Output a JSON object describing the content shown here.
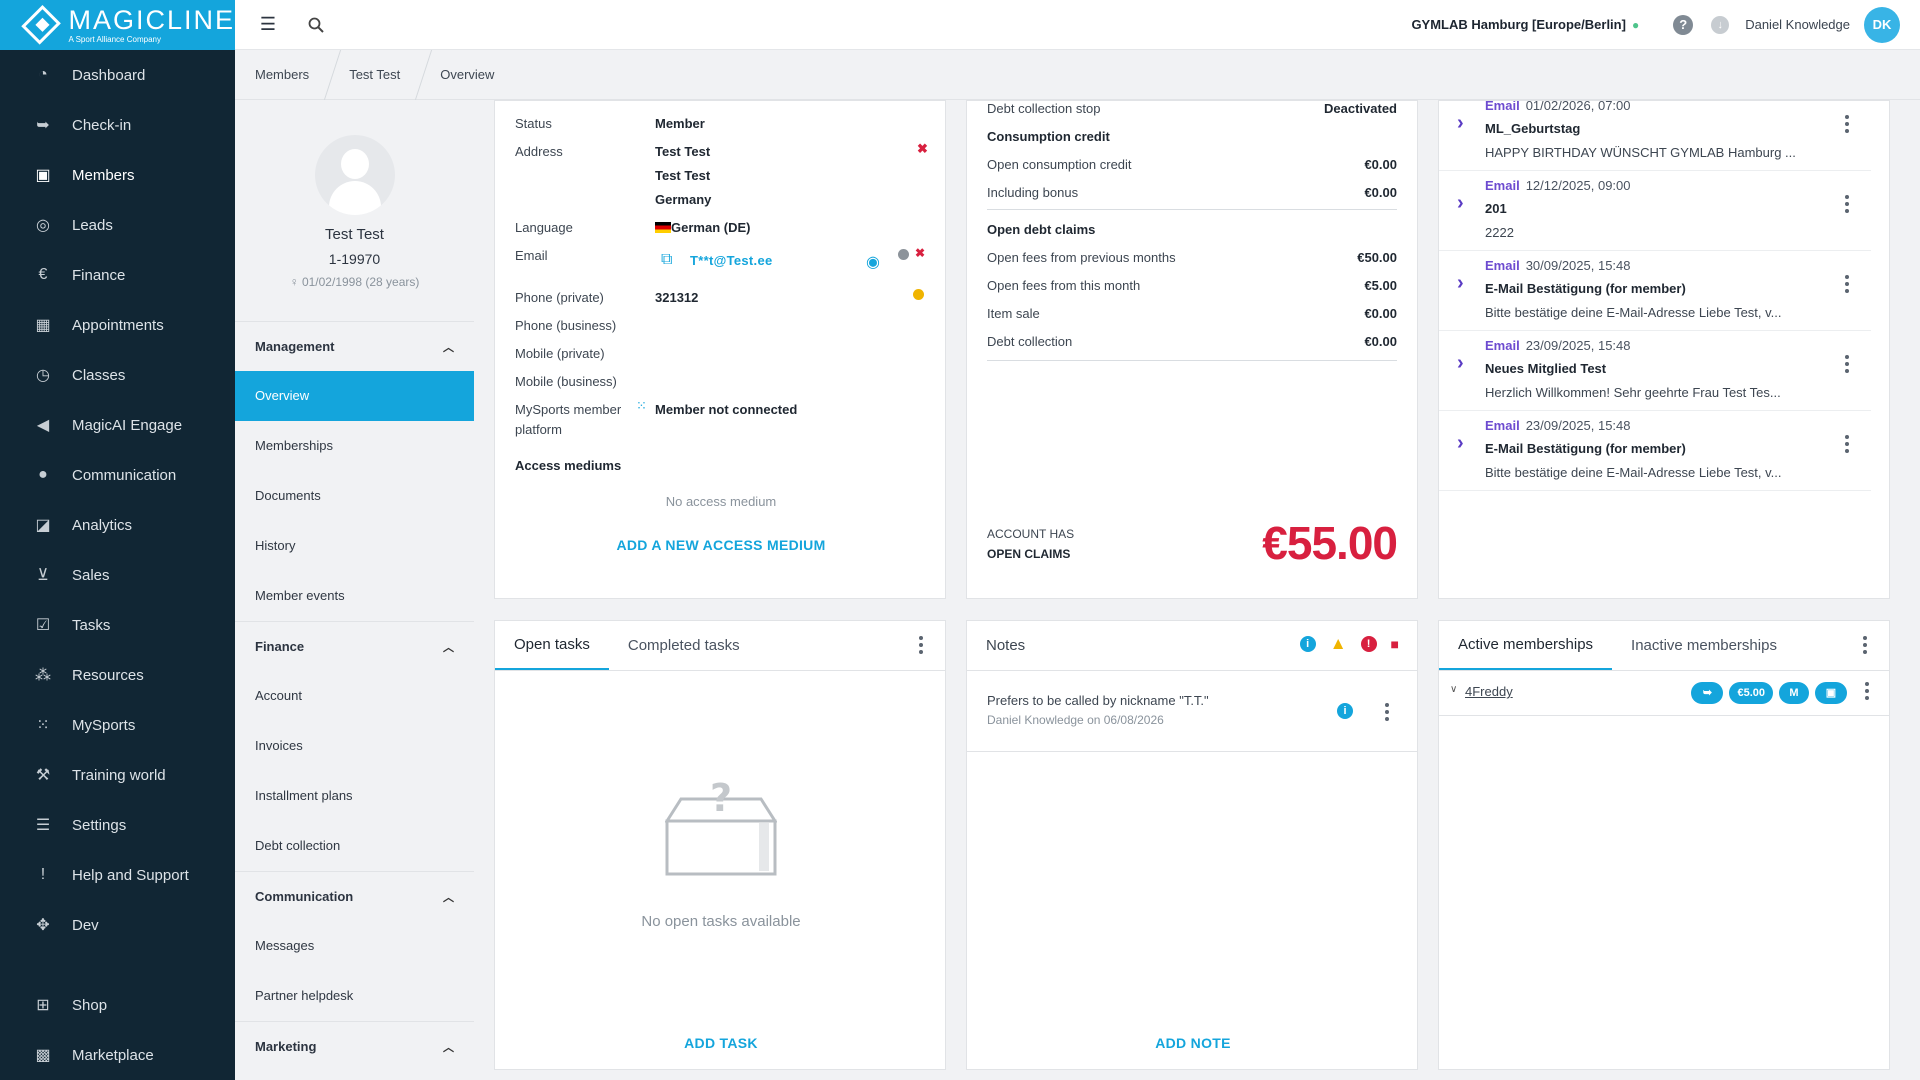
{
  "app": {
    "brand": "MAGICLINE",
    "brand_sub": "A Sport Alliance Company"
  },
  "nav": [
    {
      "label": "Dashboard",
      "icon": "dashboard-icon",
      "glyph": "◔"
    },
    {
      "label": "Check-in",
      "icon": "checkin-icon",
      "glyph": "➥"
    },
    {
      "label": "Members",
      "icon": "members-icon",
      "glyph": "▣",
      "active": true
    },
    {
      "label": "Leads",
      "icon": "leads-icon",
      "glyph": "◎"
    },
    {
      "label": "Finance",
      "icon": "finance-icon",
      "glyph": "€"
    },
    {
      "label": "Appointments",
      "icon": "calendar-icon",
      "glyph": "▦"
    },
    {
      "label": "Classes",
      "icon": "classes-icon",
      "glyph": "◷"
    },
    {
      "label": "MagicAI Engage",
      "icon": "megaphone-icon",
      "glyph": "◀"
    },
    {
      "label": "Communication",
      "icon": "chat-icon",
      "glyph": "●"
    },
    {
      "label": "Analytics",
      "icon": "analytics-icon",
      "glyph": "◪"
    },
    {
      "label": "Sales",
      "icon": "cart-icon",
      "glyph": "⊻"
    },
    {
      "label": "Tasks",
      "icon": "tasks-icon",
      "glyph": "☑"
    },
    {
      "label": "Resources",
      "icon": "resources-icon",
      "glyph": "⁂"
    },
    {
      "label": "MySports",
      "icon": "mysports-icon",
      "glyph": "⁙"
    },
    {
      "label": "Training world",
      "icon": "dumbbell-icon",
      "glyph": "⚒"
    },
    {
      "label": "Settings",
      "icon": "settings-icon",
      "glyph": "☰"
    },
    {
      "label": "Help and Support",
      "icon": "help-icon",
      "glyph": "!"
    },
    {
      "label": "Dev",
      "icon": "dev-icon",
      "glyph": "✥"
    },
    {
      "label": "Shop",
      "icon": "shop-icon",
      "glyph": "⊞"
    },
    {
      "label": "Marketplace",
      "icon": "marketplace-icon",
      "glyph": "▩"
    }
  ],
  "topbar": {
    "studio": "GYMLAB Hamburg [Europe/Berlin]",
    "user": "Daniel Knowledge",
    "initials": "DK"
  },
  "breadcrumbs": [
    "Members",
    "Test Test",
    "Overview"
  ],
  "profile": {
    "name": "Test Test",
    "number": "1-19970",
    "dob": "01/02/1998 (28 years)"
  },
  "menu": {
    "management": {
      "title": "Management",
      "items": [
        "Overview",
        "Memberships",
        "Documents",
        "History",
        "Member events"
      ]
    },
    "finance": {
      "title": "Finance",
      "items": [
        "Account",
        "Invoices",
        "Installment plans",
        "Debt collection"
      ]
    },
    "communication": {
      "title": "Communication",
      "items": [
        "Messages",
        "Partner helpdesk"
      ]
    },
    "marketing": {
      "title": "Marketing"
    }
  },
  "details": {
    "status_label": "Status",
    "status": "Member",
    "address_label": "Address",
    "address": [
      "Test Test",
      "Test Test",
      "Germany"
    ],
    "language_label": "Language",
    "language": "German (DE)",
    "email_label": "Email",
    "email": "T**t@Test.ee",
    "phone_private_label": "Phone (private)",
    "phone_private": "321312",
    "phone_business_label": "Phone (business)",
    "mobile_private_label": "Mobile (private)",
    "mobile_business_label": "Mobile (business)",
    "mysports_label_1": "MySports member",
    "mysports_label_2": "platform",
    "mysports": "Member not connected",
    "access_label": "Access mediums",
    "no_access": "No access medium",
    "add_access": "ADD A NEW ACCESS MEDIUM"
  },
  "account": {
    "debt_stop_label": "Debt collection stop",
    "debt_stop": "Deactivated",
    "consumption_title": "Consumption credit",
    "open_consumption_label": "Open consumption credit",
    "open_consumption": "€0.00",
    "bonus_label": "Including bonus",
    "bonus": "€0.00",
    "debt_title": "Open debt claims",
    "prev_months_label": "Open fees from previous months",
    "prev_months": "€50.00",
    "this_month_label": "Open fees from this month",
    "this_month": "€5.00",
    "item_sale_label": "Item sale",
    "item_sale": "€0.00",
    "debt_coll_label": "Debt collection",
    "debt_coll": "€0.00",
    "status_line1": "ACCOUNT HAS",
    "status_line2": "OPEN CLAIMS",
    "total": "€55.00",
    "total_color": "#d8203f"
  },
  "communications": [
    {
      "type": "Email",
      "date": "01/02/2026, 07:00",
      "subject": "ML_Geburtstag",
      "text": "HAPPY BIRTHDAY WÜNSCHT GYMLAB Hamburg ..."
    },
    {
      "type": "Email",
      "date": "12/12/2025, 09:00",
      "subject": "201",
      "text": "2222"
    },
    {
      "type": "Email",
      "date": "30/09/2025, 15:48",
      "subject": "E-Mail Bestätigung (for member)",
      "text": "Bitte bestätige deine E-Mail-Adresse Liebe Test, v..."
    },
    {
      "type": "Email",
      "date": "23/09/2025, 15:48",
      "subject": "Neues Mitglied Test",
      "text": "Herzlich Willkommen! Sehr geehrte Frau Test Tes..."
    },
    {
      "type": "Email",
      "date": "23/09/2025, 15:48",
      "subject": "E-Mail Bestätigung (for member)",
      "text": "Bitte bestätige deine E-Mail-Adresse Liebe Test, v..."
    }
  ],
  "tasks": {
    "tab_open": "Open tasks",
    "tab_done": "Completed tasks",
    "empty": "No open tasks available",
    "add": "ADD TASK"
  },
  "notes": {
    "title": "Notes",
    "text": "Prefers to be called by nickname \"T.T.\"",
    "meta": "Daniel Knowledge on 06/08/2026",
    "add": "ADD NOTE"
  },
  "memberships": {
    "tab_active": "Active memberships",
    "tab_inactive": "Inactive memberships",
    "name": "4Freddy",
    "price_tag": "€5.00",
    "m_tag": "M"
  },
  "colors": {
    "accent": "#14a5dc",
    "sidebar": "#112634",
    "danger": "#d8203f",
    "comm_type": "#6d4bd0"
  }
}
